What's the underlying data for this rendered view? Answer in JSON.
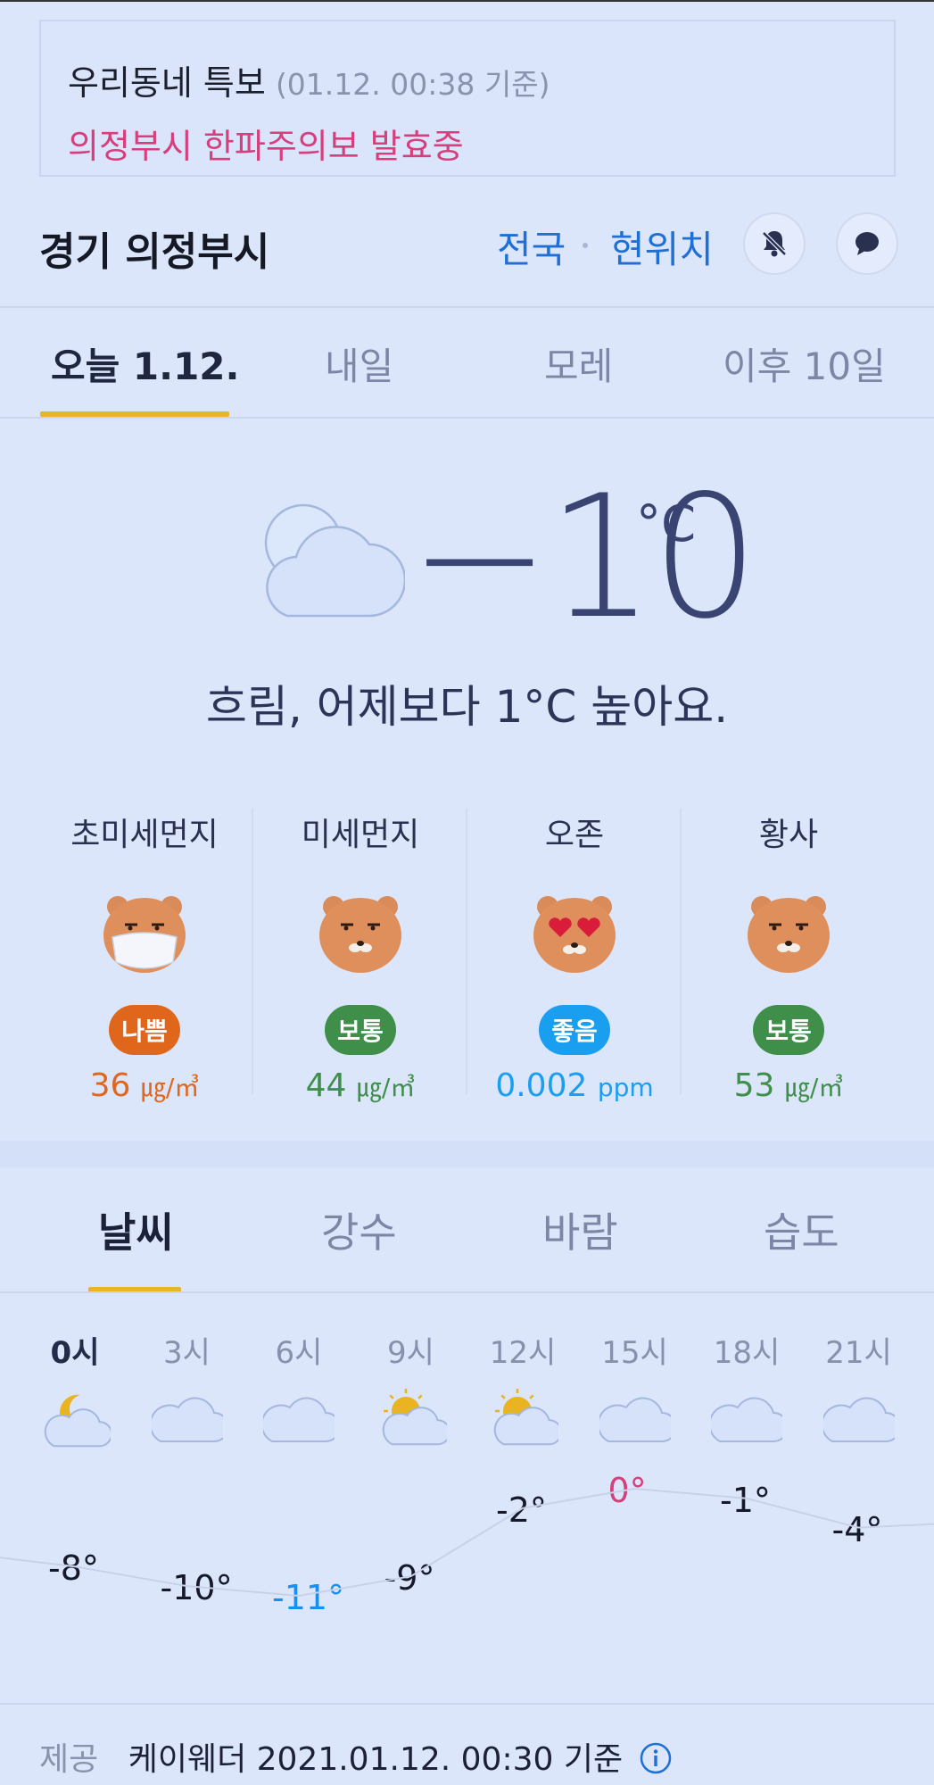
{
  "alert": {
    "title": "우리동네 특보",
    "time": "(01.12. 00:38 기준)",
    "message": "의정부시 한파주의보 발효중"
  },
  "location": {
    "name": "경기 의정부시",
    "nationwide": "전국",
    "current_location": "현위치",
    "bell_icon": "bell-off-icon",
    "chat_icon": "chat-bubble-icon"
  },
  "day_tabs": [
    {
      "label": "오늘 1.12.",
      "active": true
    },
    {
      "label": "내일",
      "active": false
    },
    {
      "label": "모레",
      "active": false
    },
    {
      "label": "이후 10일",
      "active": false
    }
  ],
  "current": {
    "icon": "cloud-icon",
    "temperature": "−10",
    "unit": "°C",
    "summary": "흐림, 어제보다 1°C 높아요."
  },
  "air_quality": [
    {
      "label": "초미세먼지",
      "face": "mask-face",
      "status": "나쁨",
      "status_color": "#e0661c",
      "value": "36",
      "unit": "㎍/㎥",
      "value_color": "#e0661c"
    },
    {
      "label": "미세먼지",
      "face": "neutral-face",
      "status": "보통",
      "status_color": "#3f8f4a",
      "value": "44",
      "unit": "㎍/㎥",
      "value_color": "#3f8f4a"
    },
    {
      "label": "오존",
      "face": "heart-eyes-face",
      "status": "좋음",
      "status_color": "#1a9ef0",
      "value": "0.002",
      "unit": "ppm",
      "value_color": "#1a9ef0"
    },
    {
      "label": "황사",
      "face": "neutral-face",
      "status": "보통",
      "status_color": "#3f8f4a",
      "value": "53",
      "unit": "㎍/㎥",
      "value_color": "#3f8f4a"
    }
  ],
  "category_tabs": [
    {
      "label": "날씨",
      "active": true
    },
    {
      "label": "강수",
      "active": false
    },
    {
      "label": "바람",
      "active": false
    },
    {
      "label": "습도",
      "active": false
    }
  ],
  "hourly": [
    {
      "time": "0시",
      "icon": "moon-cloud-icon",
      "temp": "-8°",
      "value": -8,
      "active": true
    },
    {
      "time": "3시",
      "icon": "cloud-icon",
      "temp": "-10°",
      "value": -10,
      "active": false
    },
    {
      "time": "6시",
      "icon": "cloud-icon",
      "temp": "-11°",
      "value": -11,
      "active": false
    },
    {
      "time": "9시",
      "icon": "sun-cloud-icon",
      "temp": "-9°",
      "value": -9,
      "active": false
    },
    {
      "time": "12시",
      "icon": "sun-cloud-icon",
      "temp": "-2°",
      "value": -2,
      "active": false
    },
    {
      "time": "15시",
      "icon": "cloud-icon",
      "temp": "0°",
      "value": 0,
      "active": false
    },
    {
      "time": "18시",
      "icon": "cloud-icon",
      "temp": "-1°",
      "value": -1,
      "active": false
    },
    {
      "time": "21시",
      "icon": "cloud-icon",
      "temp": "-4°",
      "value": -4,
      "active": false
    }
  ],
  "colors": {
    "max_temp": "#d63f7c",
    "min_temp": "#1a8ff0",
    "accent_underline": "#e6b528",
    "link": "#1e6fd6"
  },
  "footer": {
    "label": "제공",
    "text": "케이웨더 2021.01.12. 00:30 기준",
    "info_icon": "info-icon"
  }
}
